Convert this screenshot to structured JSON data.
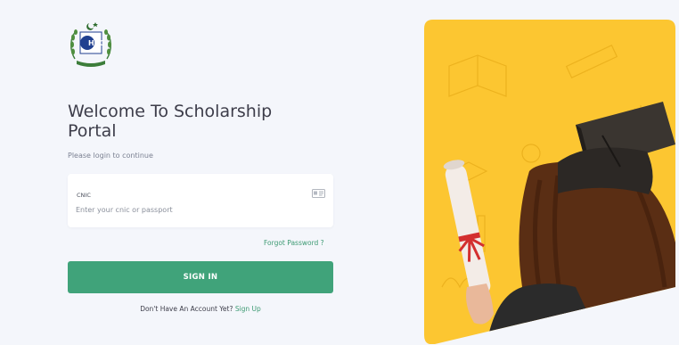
{
  "brand": {
    "logo_icon": "hec-logo-icon",
    "accent_color": "#40a37a"
  },
  "login": {
    "title_line1": "Welcome To Scholarship",
    "title_line2": "Portal",
    "subtitle": "Please login to continue",
    "cnic_label": "CNIC",
    "cnic_placeholder": "Enter your cnic or passport",
    "cnic_icon": "id-card-icon",
    "forgot_label": "Forgot Password ?",
    "signin_label": "SIGN IN",
    "no_account_text": "Don't Have An Account Yet?",
    "signup_label": "Sign Up"
  },
  "hero": {
    "background_color": "#fcc631",
    "subject": "graduate-with-diploma-illustration"
  }
}
